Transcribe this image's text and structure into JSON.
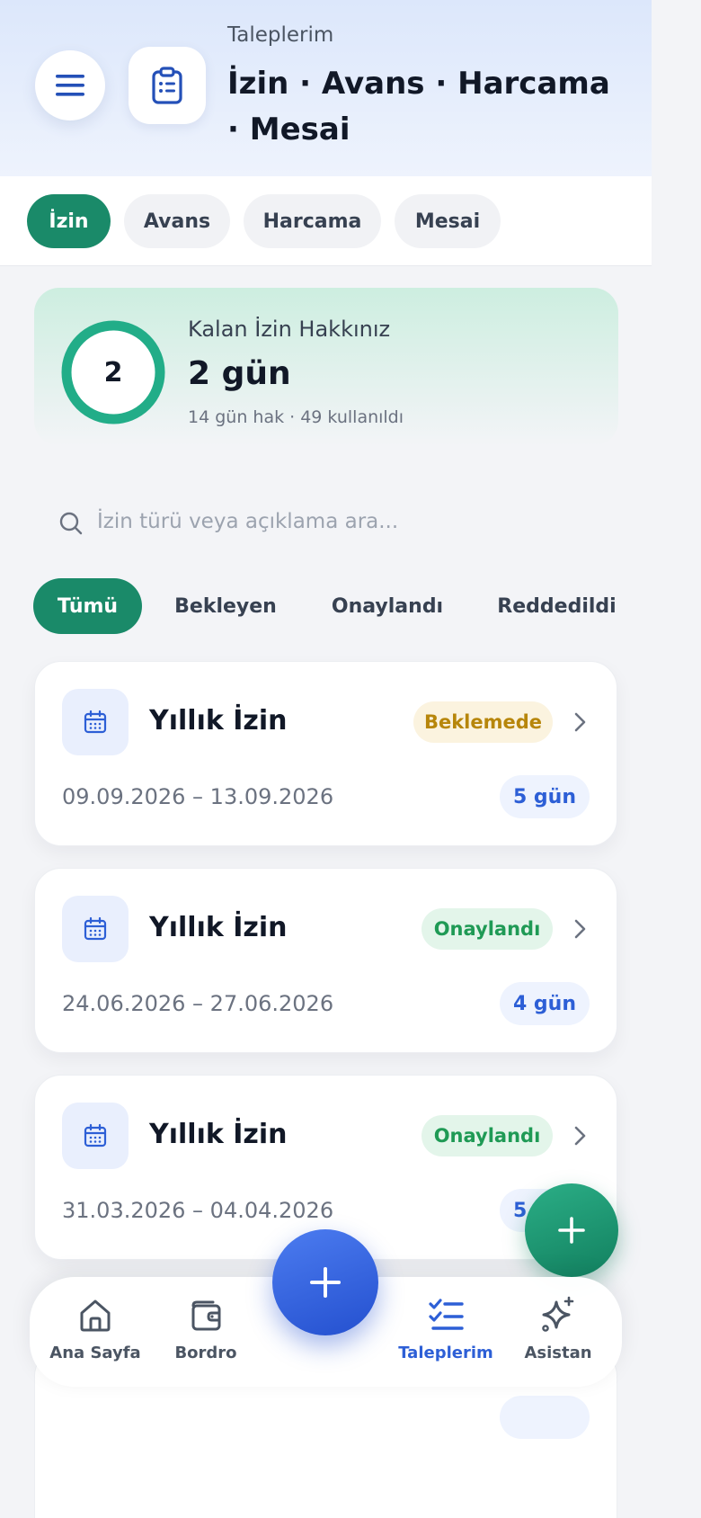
{
  "header": {
    "subtitle": "Taleplerim",
    "title": "İzin · Avans · Harcama · Mesai",
    "menu_icon": "hamburger-icon",
    "section_icon": "clipboard-icon"
  },
  "top_tabs": [
    {
      "label": "İzin",
      "active": true
    },
    {
      "label": "Avans",
      "active": false
    },
    {
      "label": "Harcama",
      "active": false
    },
    {
      "label": "Mesai",
      "active": false
    }
  ],
  "leave_balance": {
    "ring_value": "2",
    "label": "Kalan İzin Hakkınız",
    "value": "2 gün",
    "meta": "14 gün hak · 49 kullanıldı",
    "accent": "#22ad88"
  },
  "search": {
    "placeholder": "İzin türü veya açıklama ara..."
  },
  "filters": [
    {
      "label": "Tümü",
      "active": true
    },
    {
      "label": "Bekleyen",
      "active": false
    },
    {
      "label": "Onaylandı",
      "active": false
    },
    {
      "label": "Reddedildi",
      "active": false
    }
  ],
  "requests": [
    {
      "title": "Yıllık İzin",
      "status": "Beklemede",
      "status_type": "pending",
      "dates": "09.09.2026 – 13.09.2026",
      "days": "5 gün"
    },
    {
      "title": "Yıllık İzin",
      "status": "Onaylandı",
      "status_type": "approved",
      "dates": "24.06.2026 – 27.06.2026",
      "days": "4 gün"
    },
    {
      "title": "Yıllık İzin",
      "status": "Onaylandı",
      "status_type": "approved",
      "dates": "31.03.2026 – 04.04.2026",
      "days": "5 gün"
    }
  ],
  "bottom_nav": [
    {
      "label": "Ana Sayfa",
      "icon": "home-icon",
      "active": false
    },
    {
      "label": "Bordro",
      "icon": "wallet-icon",
      "active": false
    },
    {
      "label": "Taleplerim",
      "icon": "checklist-icon",
      "active": true
    },
    {
      "label": "Asistan",
      "icon": "sparkle-icon",
      "active": false
    }
  ],
  "colors": {
    "primary_green": "#1a8a69",
    "primary_blue": "#2d5fd6",
    "pending": "#b7860b",
    "approved": "#1f9a55"
  }
}
